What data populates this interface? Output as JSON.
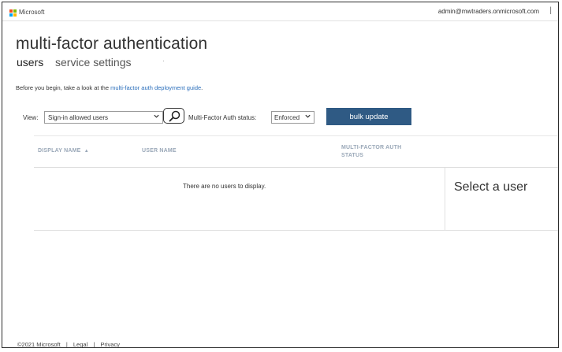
{
  "topbar": {
    "brand": "Microsoft",
    "account": "admin@mwtraders.onmicrosoft.com",
    "separator": "|",
    "logo_colors": [
      "#f25022",
      "#7fba00",
      "#00a4ef",
      "#ffb900"
    ]
  },
  "header": {
    "title": "multi-factor authentication",
    "tabs": [
      {
        "label": "users",
        "active": true
      },
      {
        "label": "service settings",
        "active": false
      }
    ]
  },
  "intro": {
    "prefix": "Before you begin, take a look at the ",
    "link": "multi-factor auth deployment guide",
    "suffix": "."
  },
  "filters": {
    "view_label": "View:",
    "view_value": "Sign-in allowed users",
    "status_label": "Multi-Factor Auth status:",
    "status_value": "Enforced",
    "bulk_label": "bulk update",
    "search_icon": "search-icon",
    "dropdown_icon": "chevron-down-icon"
  },
  "table": {
    "columns": [
      {
        "label": "DISPLAY NAME",
        "sort": "ascending"
      },
      {
        "label": "USER NAME"
      },
      {
        "label": "MULTI-FACTOR AUTH STATUS"
      }
    ],
    "sort_icon": "▲",
    "empty_message": "There are no users to display."
  },
  "detail": {
    "placeholder": "Select a user"
  },
  "footer": {
    "copyright": "©2021 Microsoft",
    "links": [
      "Legal",
      "Privacy"
    ],
    "separator": "|"
  },
  "colors": {
    "accent_button": "#2f5a84",
    "link": "#2a6ebb",
    "column_header": "#9aa8b8"
  }
}
